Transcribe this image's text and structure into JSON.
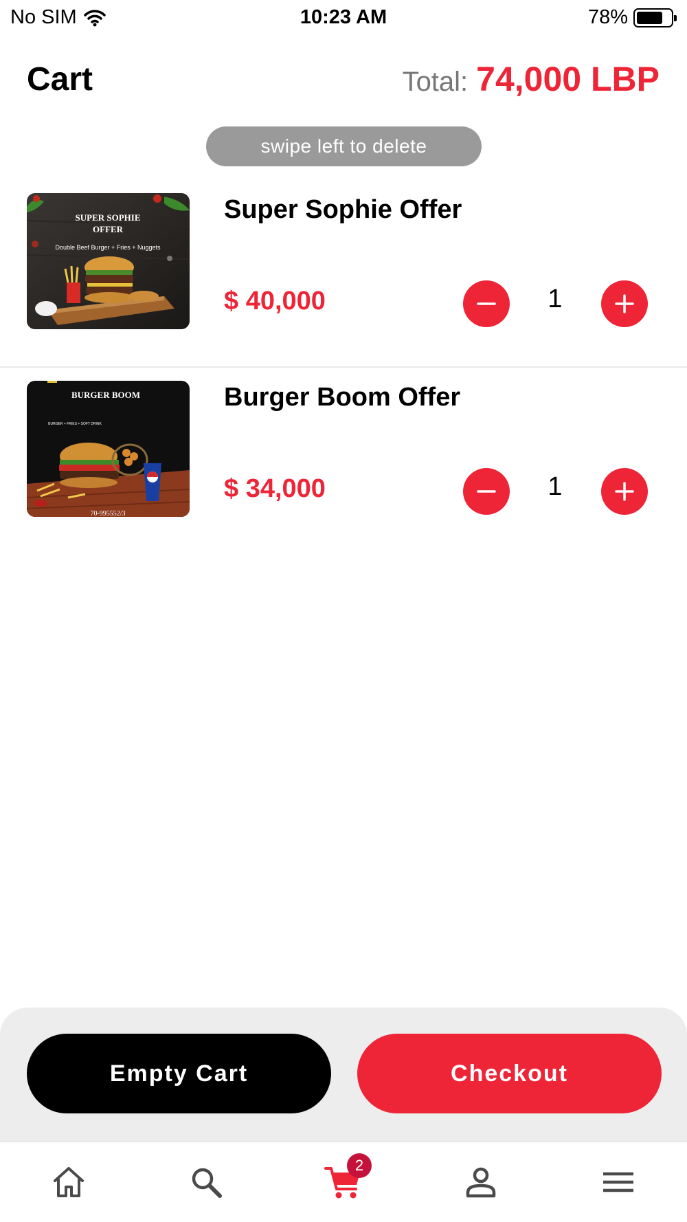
{
  "status_bar": {
    "carrier": "No SIM",
    "time": "10:23 AM",
    "battery": "78%",
    "battery_level": 0.78
  },
  "header": {
    "title": "Cart",
    "total_label": "Total:",
    "total_value": "74,000 LBP"
  },
  "hint": "swipe left to delete",
  "items": [
    {
      "name": "Super Sophie Offer",
      "price": "$ 40,000",
      "quantity": "1",
      "image": {
        "title_line1": "SUPER SOPHIE",
        "title_line2": "OFFER",
        "subtitle": "Double Beef Burger + Fries + Nuggets"
      }
    },
    {
      "name": "Burger Boom Offer",
      "price": "$ 34,000",
      "quantity": "1",
      "image": {
        "title_line1": "BURGER BOOM",
        "subtitle": "BURGER + FRIES + SOFT DRINK",
        "phone": "70-995552/3"
      }
    }
  ],
  "actions": {
    "empty_label": "Empty Cart",
    "checkout_label": "Checkout"
  },
  "tabbar": {
    "items": [
      "home-icon",
      "search-icon",
      "cart-icon",
      "profile-icon",
      "menu-icon"
    ],
    "active": "cart-icon",
    "cart_badge": "2"
  },
  "colors": {
    "accent": "#ee2437",
    "badge": "#c4123a",
    "icon_inactive": "#4a4a4a"
  }
}
